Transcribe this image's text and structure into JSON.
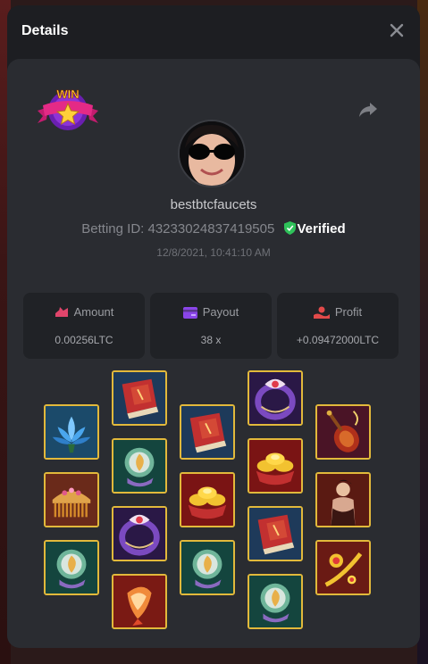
{
  "header": {
    "title": "Details"
  },
  "player": {
    "username": "bestbtcfaucets",
    "betting_id_label": "Betting ID:",
    "betting_id": "432330248374195​05",
    "verified_label": "Verified",
    "timestamp": "12/8/2021, 10:41:10 AM"
  },
  "badge": {
    "text": "WIN"
  },
  "stats": {
    "amount": {
      "label": "Amount",
      "value": "0.00256LTC"
    },
    "payout": {
      "label": "Payout",
      "value": "38 x"
    },
    "profit": {
      "label": "Profit",
      "value": "+0.09472000LTC"
    }
  },
  "colors": {
    "accent_gold": "#e2b93b",
    "amount_icon": "#e0456b",
    "payout_icon": "#8a45e8",
    "profit_icon": "#e24a4a",
    "verified_green": "#2fc25a"
  },
  "reels": [
    [
      "lotus-flower",
      "golden-comb",
      "jade-mirror"
    ],
    [
      "red-book",
      "jade-mirror",
      "purple-ring",
      "koi-fish"
    ],
    [
      "red-book",
      "gold-ingots",
      "jade-mirror"
    ],
    [
      "purple-ring",
      "gold-ingots",
      "red-book",
      "jade-mirror"
    ],
    [
      "lute",
      "dancer",
      "golden-hairpin"
    ]
  ]
}
